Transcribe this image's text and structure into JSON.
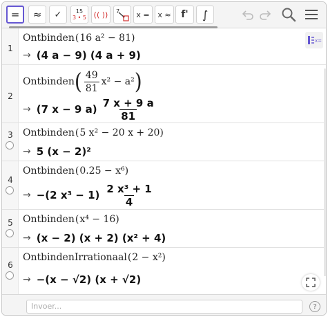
{
  "toolbar": {
    "buttons": [
      {
        "label": "=",
        "name": "evaluate"
      },
      {
        "label": "≈",
        "name": "numeric"
      },
      {
        "label": "✓",
        "name": "keep-input"
      },
      {
        "label_top": "15",
        "label_bottom": "3 • 5",
        "name": "factor"
      },
      {
        "label": "(( ))",
        "name": "expand"
      },
      {
        "label": "7",
        "name": "substitute"
      },
      {
        "label": "x =",
        "name": "solve"
      },
      {
        "label": "x ≈",
        "name": "solve-numeric"
      },
      {
        "label": "f'",
        "name": "derivative"
      },
      {
        "label": "∫",
        "name": "integral"
      }
    ],
    "undo_icon": "undo-icon",
    "redo_icon": "redo-icon",
    "search_icon": "search-icon",
    "menu_icon": "menu-icon"
  },
  "rows": [
    {
      "number": "1",
      "input_cmd": "Ontbinden",
      "input_args": "16 a² − 81",
      "output": "(4 a − 9) (4 a + 9)"
    },
    {
      "number": "2",
      "input_cmd": "Ontbinden",
      "input_frac_num": "49",
      "input_frac_den": "81",
      "input_tail": "x² − a²",
      "output_pre": "(7 x − 9 a)",
      "output_frac_num": "7 x + 9 a",
      "output_frac_den": "81"
    },
    {
      "number": "3",
      "input_cmd": "Ontbinden",
      "input_args": "5 x² − 20 x + 20",
      "output": "5 (x − 2)²"
    },
    {
      "number": "4",
      "input_cmd": "Ontbinden",
      "input_args": "0.25 − x⁶",
      "output_pre": "−(2 x³ − 1)",
      "output_frac_num": "2 x³ + 1",
      "output_frac_den": "4"
    },
    {
      "number": "5",
      "input_cmd": "Ontbinden",
      "input_args": "x⁴ − 16",
      "output": "(x − 2) (x + 2) (x² + 4)"
    },
    {
      "number": "6",
      "input_cmd": "OntbindenIrrationaal",
      "input_args": "2 − x²",
      "output": "−(x − √2) (x + √2)"
    }
  ],
  "input_bar": {
    "placeholder": "Invoer..."
  },
  "help_label": "?",
  "arrow": "→",
  "side_button_label": "x=",
  "colors": {
    "accent": "#6557d2",
    "toolbar_bg": "#f4f4f4",
    "gutter_bg": "#f6f6f6",
    "red": "#d32f2f"
  }
}
